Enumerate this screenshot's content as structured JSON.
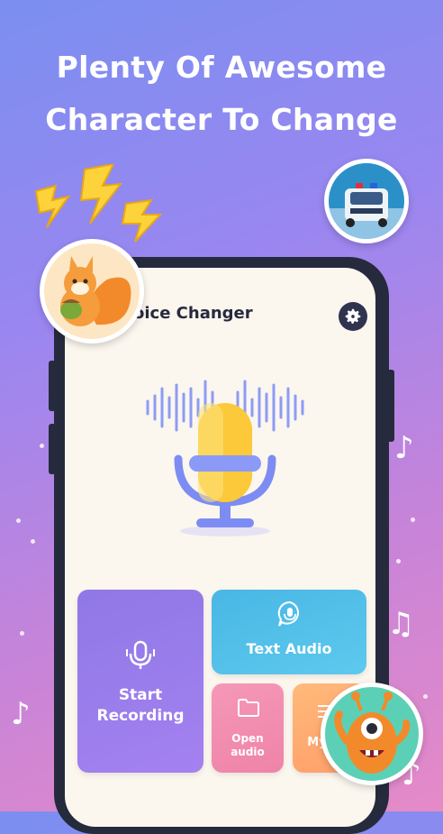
{
  "headline": {
    "line1": "Plenty Of Awesome",
    "line2": "Character To Change"
  },
  "app": {
    "title": "oice Changer",
    "icon_settings": "gear-icon"
  },
  "tiles": {
    "start_recording": {
      "line1": "Start",
      "line2": "Recording",
      "icon": "microphone-icon"
    },
    "text_audio": {
      "label": "Text Audio",
      "icon": "chat-microphone-icon"
    },
    "open_audio": {
      "line1": "Open",
      "line2": "audio",
      "icon": "folder-icon"
    },
    "my_audio": {
      "label": "My",
      "icon": "list-icon"
    }
  },
  "colors": {
    "accent": "#8f78e6",
    "text_audio": "#48b7e4",
    "open_audio": "#f598b8",
    "my_audio": "#ffba7a",
    "mic_yellow": "#fbc93a",
    "mic_blue": "#7d8cf2"
  }
}
